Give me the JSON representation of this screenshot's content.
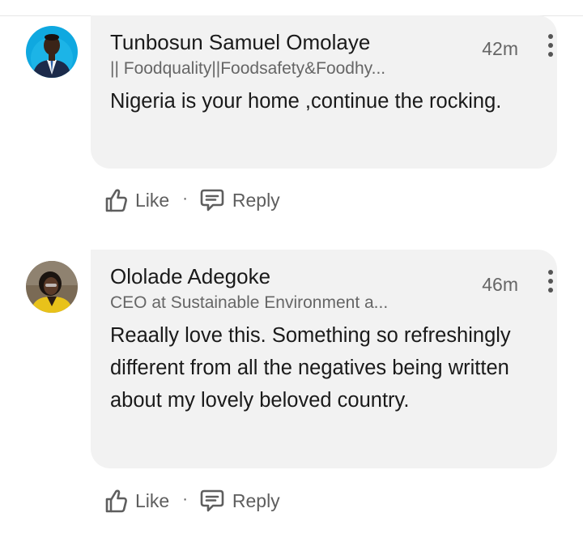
{
  "comments": [
    {
      "author": "Tunbosun Samuel Omolaye",
      "headline": "|| Foodquality||Foodsafety&Foodhy...",
      "time": "42m",
      "text": "Nigeria is your home ,continue the rocking.",
      "like_label": "Like",
      "separator": "·",
      "reply_label": "Reply",
      "avatar_bg": "#0fa8e0"
    },
    {
      "author": "Ololade Adegoke",
      "headline": "CEO at Sustainable Environment a...",
      "time": "46m",
      "text": "Reaally love this. Something so refreshingly different from all the negatives being written about my lovely beloved country.",
      "like_label": "Like",
      "separator": "·",
      "reply_label": "Reply",
      "avatar_bg": "#7a6a55"
    }
  ]
}
